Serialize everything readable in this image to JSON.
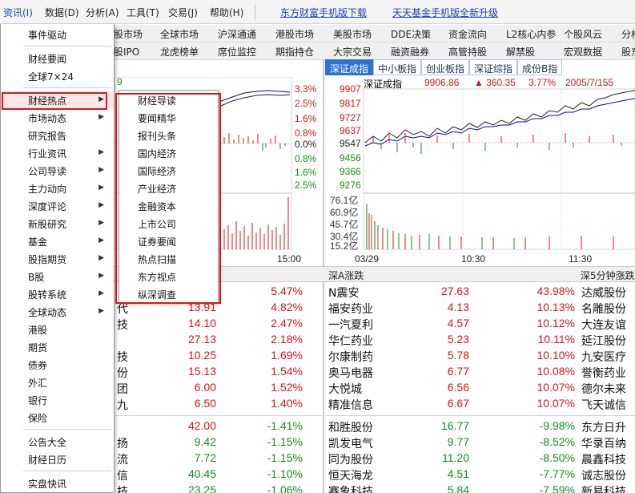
{
  "menubar": {
    "items": [
      "资讯(I)",
      "数据(D)",
      "分析(A)",
      "工具(T)",
      "交易(J)",
      "帮助(H)"
    ],
    "links": [
      "东方财富手机版下载",
      "天天基金手机版全新升级"
    ]
  },
  "nav_row1": [
    "股市场",
    "全球市场",
    "沪深通通",
    "港股市场",
    "美股市场",
    "DDE决策",
    "资金流向",
    "L2核心内参",
    "个股风云",
    "分析"
  ],
  "nav_row2": [
    "股IPO",
    "龙虎榜单",
    "席位监控",
    "期指持仓",
    "大宗交易",
    "融资融券",
    "高管持股",
    "解禁股",
    "宏观数据",
    "股东"
  ],
  "tabs": [
    "深证成指",
    "中小板指",
    "创业板指",
    "深证综指",
    "成份B指"
  ],
  "left_chart": {
    "pct_labels": [
      "3.3%",
      "2.5%",
      "1.6%",
      "0.8%",
      "0.0%",
      "0.8%",
      "1.6%",
      "2.5%"
    ],
    "time_label": "15:00",
    "top_marker": "9"
  },
  "right_chart": {
    "index_name": "深证成指",
    "index_value": "9906.86",
    "change": "▲ 360.35",
    "change_pct": "3.77%",
    "ratio": "2005/7/155",
    "price_labels": [
      "9907",
      "9817",
      "9727",
      "9637",
      "9547",
      "9456",
      "9366",
      "9276"
    ],
    "vol_labels": [
      "76.1亿",
      "60.9亿",
      "45.7亿",
      "30.4亿",
      "15.2亿"
    ],
    "time_labels": [
      "03/29",
      "10:30",
      "11:30"
    ]
  },
  "table_headers": {
    "mid": "深A涨跌",
    "right": "深5分钟涨跌"
  },
  "left_col": [
    {
      "name": "",
      "price": "",
      "pct": "5.47%"
    },
    {
      "name": "代",
      "price": "13.91",
      "pct": "4.82%"
    },
    {
      "name": "技",
      "price": "14.10",
      "pct": "2.47%"
    },
    {
      "name": "",
      "price": "27.13",
      "pct": "2.18%"
    },
    {
      "name": "技",
      "price": "10.25",
      "pct": "1.69%"
    },
    {
      "name": "份",
      "price": "15.13",
      "pct": "1.54%"
    },
    {
      "name": "团",
      "price": "6.00",
      "pct": "1.52%"
    },
    {
      "name": "九",
      "price": "6.50",
      "pct": "1.40%"
    },
    {
      "name": "",
      "price": "42.00",
      "pct": "-1.41%"
    },
    {
      "name": "扬",
      "price": "9.42",
      "pct": "-1.15%"
    },
    {
      "name": "流",
      "price": "7.72",
      "pct": "-1.15%"
    },
    {
      "name": "信",
      "price": "40.45",
      "pct": "-1.10%"
    },
    {
      "name": "技",
      "price": "23.25",
      "pct": "-1.06%"
    }
  ],
  "mid_col": [
    {
      "name": "N震安",
      "price": "27.63",
      "pct": "43.98%"
    },
    {
      "name": "福安药业",
      "price": "4.13",
      "pct": "10.13%"
    },
    {
      "name": "一汽夏利",
      "price": "4.57",
      "pct": "10.12%"
    },
    {
      "name": "华仁药业",
      "price": "5.23",
      "pct": "10.11%"
    },
    {
      "name": "尔康制药",
      "price": "5.78",
      "pct": "10.10%"
    },
    {
      "name": "奥马电器",
      "price": "6.77",
      "pct": "10.08%"
    },
    {
      "name": "大悦城",
      "price": "6.56",
      "pct": "10.07%"
    },
    {
      "name": "精准信息",
      "price": "6.67",
      "pct": "10.07%"
    },
    {
      "name": "和胜股份",
      "price": "16.77",
      "pct": "-9.98%"
    },
    {
      "name": "凯发电气",
      "price": "9.77",
      "pct": "-8.52%"
    },
    {
      "name": "同为股份",
      "price": "11.20",
      "pct": "-8.50%"
    },
    {
      "name": "恒天海龙",
      "price": "4.51",
      "pct": "-7.77%"
    },
    {
      "name": "赛象科技",
      "price": "5.84",
      "pct": "-7.59%"
    }
  ],
  "right_col": [
    "达威股份",
    "名雕股份",
    "大连友谊",
    "延江股份",
    "九安医疗",
    "誉衡药业",
    "德尔未来",
    "飞天诚信",
    "东方日升",
    "华录百纳",
    "晨鑫科技",
    "诚志股份",
    "新易科技"
  ],
  "menu1": {
    "items": [
      {
        "label": "事件驱动",
        "arrow": false
      },
      {
        "sep": true
      },
      {
        "label": "财经要闻",
        "arrow": false
      },
      {
        "label": "全球7×24",
        "arrow": false
      },
      {
        "sep": true
      },
      {
        "label": "财经热点",
        "arrow": true,
        "hl": true
      },
      {
        "label": "市场动态",
        "arrow": true
      },
      {
        "label": "研究报告",
        "arrow": false
      },
      {
        "label": "行业资讯",
        "arrow": true
      },
      {
        "label": "公司导读",
        "arrow": true
      },
      {
        "label": "主力动向",
        "arrow": true
      },
      {
        "label": "深度评论",
        "arrow": true
      },
      {
        "label": "新股研究",
        "arrow": true
      },
      {
        "label": "基金",
        "arrow": true
      },
      {
        "label": "股指期货",
        "arrow": true
      },
      {
        "label": "B股",
        "arrow": true
      },
      {
        "label": "股转系统",
        "arrow": true
      },
      {
        "label": "全球动态",
        "arrow": true
      },
      {
        "label": "港股",
        "arrow": false
      },
      {
        "label": "期货",
        "arrow": false
      },
      {
        "label": "债券",
        "arrow": false
      },
      {
        "label": "外汇",
        "arrow": false
      },
      {
        "label": "银行",
        "arrow": false
      },
      {
        "label": "保险",
        "arrow": false
      },
      {
        "sep": true
      },
      {
        "label": "公告大全",
        "arrow": false
      },
      {
        "label": "财经日历",
        "arrow": false
      },
      {
        "sep": true
      },
      {
        "label": "实盘快讯",
        "arrow": false
      }
    ]
  },
  "menu2": {
    "items": [
      "财经导读",
      "要闻精华",
      "报刊头条",
      "国内经济",
      "国际经济",
      "产业经济",
      "金融资本",
      "上市公司",
      "证券要闻",
      "热点扫描",
      "东方视点",
      "纵深调查"
    ]
  },
  "colors": {
    "up": "#d8141c",
    "down": "#148c1e",
    "tab_active": "#2f73d0",
    "highlight_box": "#e0151b"
  }
}
